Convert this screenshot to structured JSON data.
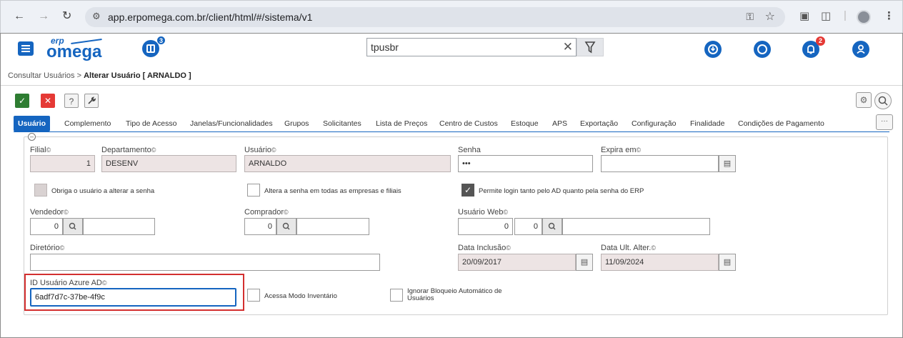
{
  "browser": {
    "url": "app.erpomega.com.br/client/html/#/sistema/v1",
    "back_icon": "arrow-left-icon",
    "forward_icon": "arrow-right-icon",
    "reload_icon": "reload-icon"
  },
  "topbar": {
    "logo_top": "erp",
    "logo_main": "omega",
    "modules_badge": "3",
    "search_value": "tpusbr",
    "notifications_badge": "2"
  },
  "breadcrumb": {
    "parent": "Consultar Usuários",
    "separator": ">",
    "current": "Alterar Usuário [ ARNALDO ]"
  },
  "toolbar": {
    "save_icon": "✓",
    "cancel_icon": "✕",
    "help_icon": "?",
    "tools_icon": "wrench-icon"
  },
  "tabs": [
    {
      "label": "Usuário",
      "active": true
    },
    {
      "label": "Complemento"
    },
    {
      "label": "Tipo de Acesso"
    },
    {
      "label": "Janelas/Funcionalidades"
    },
    {
      "label": "Grupos"
    },
    {
      "label": "Solicitantes"
    },
    {
      "label": "Lista de Preços"
    },
    {
      "label": "Centro de Custos"
    },
    {
      "label": "Estoque"
    },
    {
      "label": "APS"
    },
    {
      "label": "Exportação"
    },
    {
      "label": "Configuração"
    },
    {
      "label": "Finalidade"
    },
    {
      "label": "Condições de Pagamento"
    }
  ],
  "tabs_more": "···",
  "form": {
    "filial": {
      "label": "Filial",
      "value": "1"
    },
    "departamento": {
      "label": "Departamento",
      "value": "DESENV"
    },
    "usuario": {
      "label": "Usuário",
      "value": "ARNALDO"
    },
    "senha": {
      "label": "Senha",
      "value": "•••"
    },
    "expira_em": {
      "label": "Expira em",
      "value": ""
    },
    "obriga_alterar": {
      "label": "Obriga o usuário a alterar a senha",
      "checked": false
    },
    "altera_todas": {
      "label": "Altera a senha em todas as empresas e filiais",
      "checked": false
    },
    "permite_login": {
      "label": "Permite login tanto pelo AD quanto pela senha do ERP",
      "checked": true
    },
    "vendedor": {
      "label": "Vendedor",
      "value": "0",
      "name": ""
    },
    "comprador": {
      "label": "Comprador",
      "value": "0",
      "name": ""
    },
    "usuario_web": {
      "label": "Usuário Web",
      "value1": "0",
      "value2": "0",
      "name": ""
    },
    "diretorio": {
      "label": "Diretório",
      "value": ""
    },
    "data_inclusao": {
      "label": "Data Inclusão",
      "value": "20/09/2017"
    },
    "data_ult_alter": {
      "label": "Data Ult. Alter.",
      "value": "11/09/2024"
    },
    "id_azure": {
      "label": "ID Usuário Azure AD",
      "value": "6adf7d7c-37be-4f9c"
    },
    "acessa_inventario": {
      "label": "Acessa Modo Inventário",
      "checked": false
    },
    "ignorar_bloqueio": {
      "label1": "Ignorar Bloqueio Automático de",
      "label2": "Usuários",
      "checked": false
    }
  },
  "copy_icon": "©",
  "colors": {
    "accent": "#1565c0",
    "save": "#2e7d32",
    "cancel": "#e53935",
    "highlight": "#d32f2f",
    "readonly": "#ede4e4"
  }
}
